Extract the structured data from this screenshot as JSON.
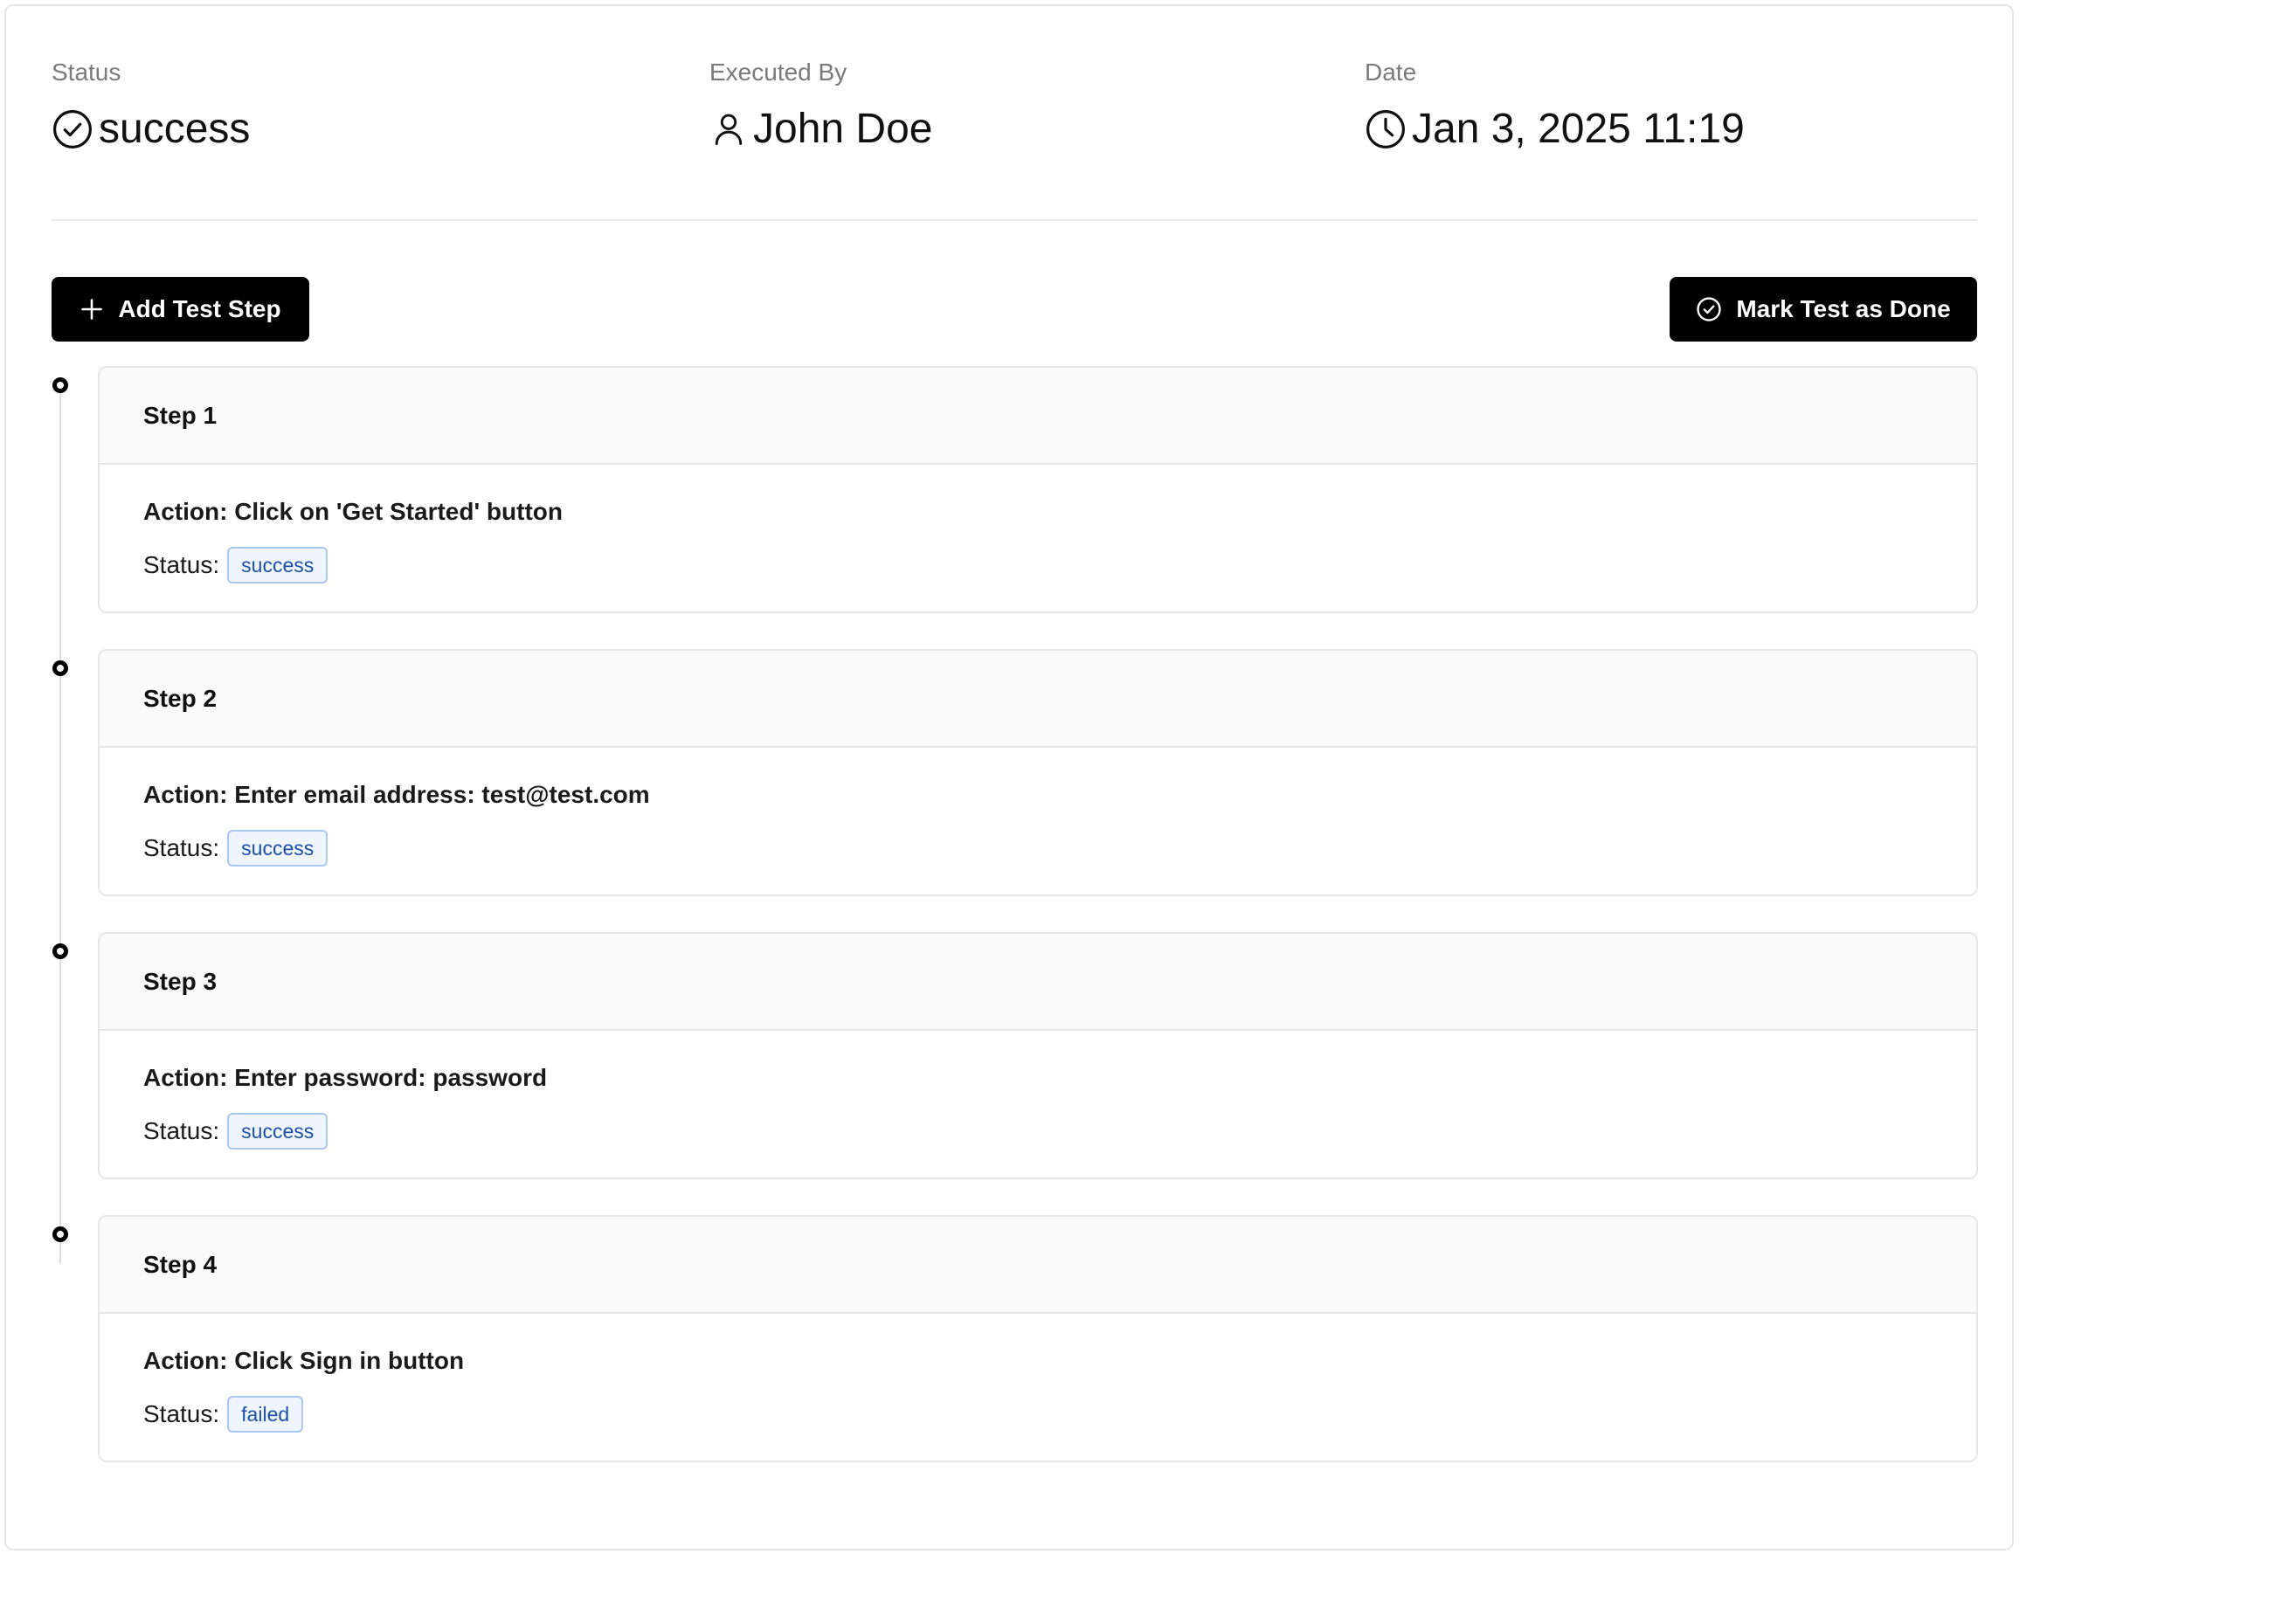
{
  "summary": {
    "status": {
      "label": "Status",
      "value": "success",
      "icon": "check-circle-icon"
    },
    "executed_by": {
      "label": "Executed By",
      "value": "John Doe",
      "icon": "user-icon"
    },
    "date": {
      "label": "Date",
      "value": "Jan 3, 2025 11:19",
      "icon": "clock-icon"
    }
  },
  "toolbar": {
    "add_step_label": "Add Test Step",
    "add_step_icon": "plus-icon",
    "mark_done_label": "Mark Test as Done",
    "mark_done_icon": "check-circle-icon"
  },
  "status_prefix": "Status:",
  "steps": [
    {
      "title": "Step 1",
      "action": "Action: Click on 'Get Started' button",
      "status": "success"
    },
    {
      "title": "Step 2",
      "action": "Action: Enter email address: test@test.com",
      "status": "success"
    },
    {
      "title": "Step 3",
      "action": "Action: Enter password: password",
      "status": "success"
    },
    {
      "title": "Step 4",
      "action": "Action: Click Sign in button",
      "status": "failed"
    }
  ],
  "colors": {
    "button_bg": "#000000",
    "badge_bg": "#eef5ff",
    "badge_border": "#a9c8f3",
    "badge_text": "#1d4fa6",
    "label_gray": "#7a7a7a"
  }
}
